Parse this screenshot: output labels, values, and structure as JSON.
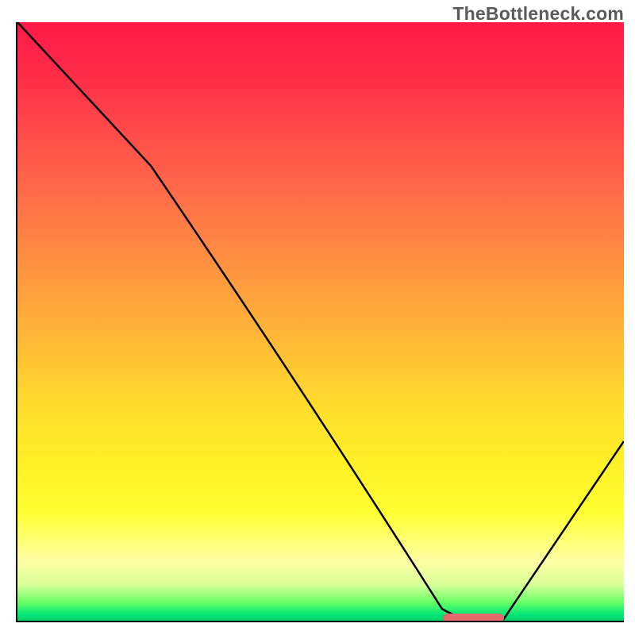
{
  "attribution": "TheBottleneck.com",
  "chart_data": {
    "type": "line",
    "title": "",
    "xlabel": "",
    "ylabel": "",
    "xlim": [
      0,
      100
    ],
    "ylim": [
      0,
      100
    ],
    "series": [
      {
        "name": "curve",
        "x": [
          0,
          22,
          70,
          74,
          80,
          100
        ],
        "y": [
          100,
          76,
          2,
          0,
          0,
          30
        ]
      }
    ],
    "marker": {
      "x_start": 70,
      "x_end": 80,
      "y": 0.6,
      "color": "#e26a6a"
    },
    "gradient_stops": [
      {
        "pos": 0,
        "color": "#ff1a47"
      },
      {
        "pos": 50,
        "color": "#ffb838"
      },
      {
        "pos": 82,
        "color": "#ffff33"
      },
      {
        "pos": 100,
        "color": "#00d26a"
      }
    ]
  }
}
